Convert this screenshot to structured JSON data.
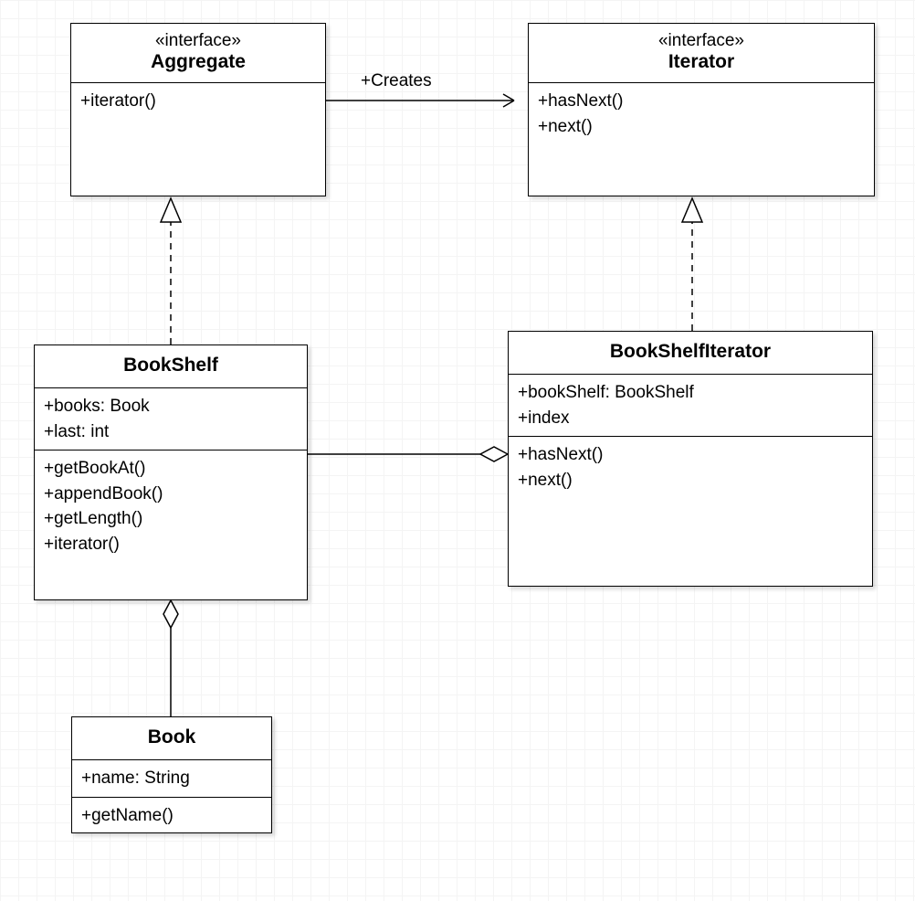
{
  "classes": {
    "aggregate": {
      "stereotype": "«interface»",
      "name": "Aggregate",
      "methods": [
        "+iterator()"
      ]
    },
    "iterator": {
      "stereotype": "«interface»",
      "name": "Iterator",
      "methods": [
        "+hasNext()",
        "+next()"
      ]
    },
    "bookshelf": {
      "name": "BookShelf",
      "attributes": [
        "+books: Book",
        "+last: int"
      ],
      "methods": [
        "+getBookAt()",
        "+appendBook()",
        "+getLength()",
        "+iterator()"
      ]
    },
    "bookshelfiterator": {
      "name": "BookShelfIterator",
      "attributes": [
        "+bookShelf: BookShelf",
        "+index"
      ],
      "methods": [
        "+hasNext()",
        "+next()"
      ]
    },
    "book": {
      "name": "Book",
      "attributes": [
        "+name: String"
      ],
      "methods": [
        "+getName()"
      ]
    }
  },
  "relationships": {
    "creates": "+Creates"
  }
}
